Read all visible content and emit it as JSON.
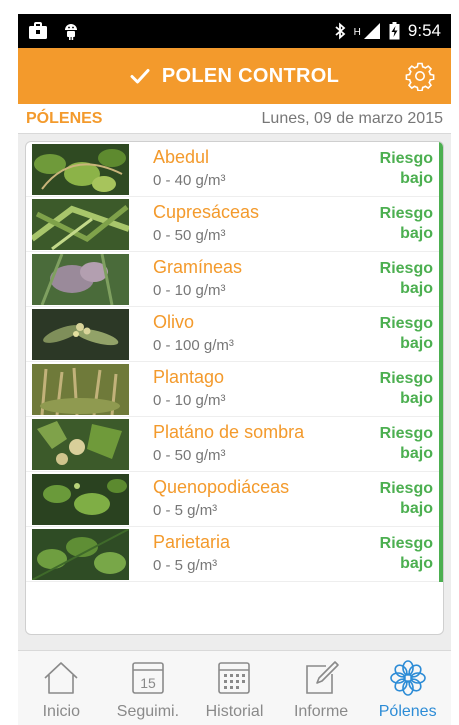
{
  "status_bar": {
    "time": "9:54",
    "network": "H",
    "icons": [
      "briefcase-icon",
      "android-icon",
      "bluetooth-icon",
      "signal-icon",
      "battery-charging-icon"
    ]
  },
  "app_bar": {
    "title": "POLEN CONTROL",
    "check_icon": "check-icon",
    "settings_icon": "gear-icon"
  },
  "section": {
    "title": "PÓLENES",
    "date": "Lunes, 09 de marzo 2015"
  },
  "pollens": [
    {
      "name": "Abedul",
      "range": "0 - 40 g/m³",
      "risk_line1": "Riesgo",
      "risk_line2": "bajo"
    },
    {
      "name": "Cupresáceas",
      "range": "0 - 50 g/m³",
      "risk_line1": "Riesgo",
      "risk_line2": "bajo"
    },
    {
      "name": "Gramíneas",
      "range": "0 - 10 g/m³",
      "risk_line1": "Riesgo",
      "risk_line2": "bajo"
    },
    {
      "name": "Olivo",
      "range": "0 - 100 g/m³",
      "risk_line1": "Riesgo",
      "risk_line2": "bajo"
    },
    {
      "name": "Plantago",
      "range": "0 - 10 g/m³",
      "risk_line1": "Riesgo",
      "risk_line2": "bajo"
    },
    {
      "name": "Platáno de sombra",
      "range": "0 - 50 g/m³",
      "risk_line1": "Riesgo",
      "risk_line2": "bajo"
    },
    {
      "name": "Quenopodiáceas",
      "range": "0 - 5 g/m³",
      "risk_line1": "Riesgo",
      "risk_line2": "bajo"
    },
    {
      "name": "Parietaria",
      "range": "0 - 5 g/m³",
      "risk_line1": "Riesgo",
      "risk_line2": "bajo"
    }
  ],
  "colors": {
    "accent": "#f39a2c",
    "risk_low": "#4caf50",
    "active_nav": "#2d8cd6",
    "inactive_nav": "#8a8a8a"
  },
  "bottom_nav": [
    {
      "label": "Inicio",
      "icon": "home-icon",
      "active": false
    },
    {
      "label": "Seguimi.",
      "icon": "calendar-day-icon",
      "day": "15",
      "active": false
    },
    {
      "label": "Historial",
      "icon": "calendar-grid-icon",
      "active": false
    },
    {
      "label": "Informe",
      "icon": "edit-note-icon",
      "active": false
    },
    {
      "label": "Pólenes",
      "icon": "flower-icon",
      "active": true
    }
  ]
}
